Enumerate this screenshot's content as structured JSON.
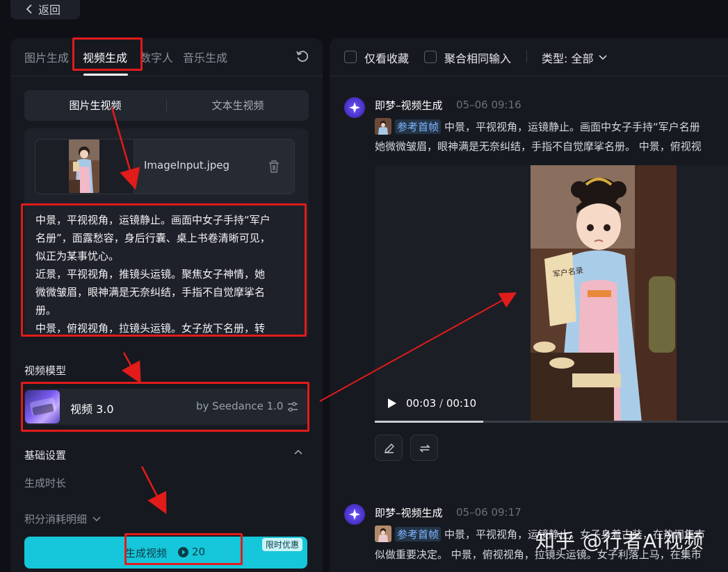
{
  "back_button": {
    "label": "返回"
  },
  "left": {
    "tabs": [
      {
        "label": "图片生成"
      },
      {
        "label": "视频生成",
        "active": true
      },
      {
        "label": "数字人"
      },
      {
        "label": "音乐生成"
      }
    ],
    "mode_tabs": [
      {
        "label": "图片生视频",
        "active": true
      },
      {
        "label": "文本生视频"
      }
    ],
    "upload": {
      "file_name": "ImageInput.jpeg"
    },
    "prompt_lines": [
      "中景，平视视角，运镜静止。画面中女子手持“军户",
      "名册”，面露愁容，身后行囊、桌上书卷清晰可见，",
      "似正为某事忧心。",
      "近景，平视视角，推镜头运镜。聚焦女子神情，她",
      "微微皱眉，眼神满是无奈纠结，手指不自觉摩挲名",
      "册。",
      "中景，俯视视角，拉镜头运镜。女子放下名册，转"
    ],
    "video_model_label": "视频模型",
    "model": {
      "name": "视频 3.0",
      "by": "by Seedance 1.0"
    },
    "basic_settings_label": "基础设置",
    "duration_label": "生成时长",
    "credit_detail_label": "积分消耗明细",
    "generate": {
      "label": "生成视频",
      "credits": "20",
      "promo": "限时优惠"
    }
  },
  "right": {
    "filters": {
      "only_favorites": "仅看收藏",
      "merge_same_input": "聚合相同输入",
      "type_label": "类型: 全部"
    },
    "messages": [
      {
        "sender": "即梦–视频生成",
        "time": "05–06  09:16",
        "ref_tag": "参考首帧",
        "line1_rest": " 中景，平视视角，运镜静止。画面中女子手持“军户名册",
        "line2": "她微微皱眉，眼神满是无奈纠结，手指不自觉摩挲名册。 中景，俯视视"
      },
      {
        "sender": "即梦–视频生成",
        "time": "05–06  09:17",
        "ref_tag": "参考首帧",
        "line1_rest": " 中景，平视视角，运镜静止。女子身着古装，在热闹集市",
        "line2": "似做重要决定。 中景，俯视视角，拉镜头运镜。女子利落上马，在集市"
      }
    ],
    "video": {
      "current": "00:03",
      "separator": " / ",
      "duration": "00:10",
      "progress": 0.3
    },
    "scroll_text": {
      "frame_text": "军户名录"
    }
  },
  "watermark": "知乎 @行者AI视频",
  "colors": {
    "accent": "#16c6da",
    "highlight_box": "#e21b1b",
    "panel_bg": "#16191f"
  }
}
